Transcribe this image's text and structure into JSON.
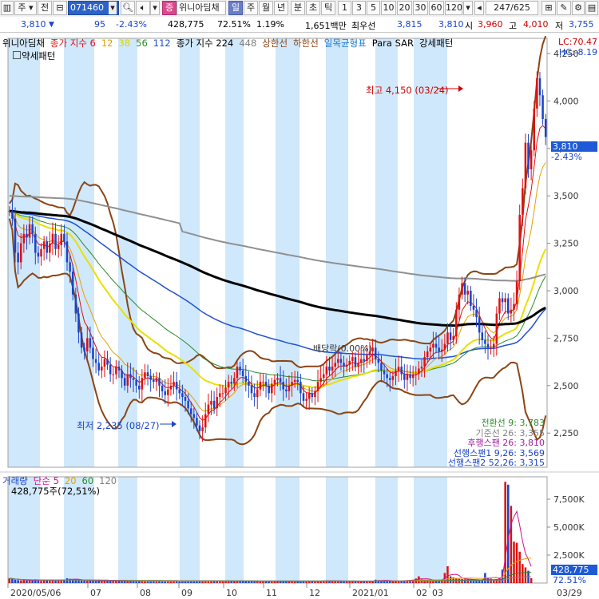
{
  "toolbar": {
    "type_label": "주",
    "prev_label": "전",
    "code": "071460",
    "stock_name": "위니아딤채",
    "stock_badge": "증",
    "periods": [
      "일",
      "주",
      "월",
      "년",
      "분",
      "초",
      "틱"
    ],
    "selected_period": "일",
    "intervals": [
      "1",
      "3",
      "5",
      "10",
      "20",
      "30",
      "60",
      "120"
    ],
    "page_count": "247/625"
  },
  "quote": {
    "price": "3,810",
    "change": "95",
    "change_pct": "-2.43%",
    "volume": "428,775",
    "vol_ratio": "72.51%",
    "turnover": "1.19%",
    "amount": "1,651백만",
    "best_ask_label": "최우선",
    "best_ask": "3,815",
    "bid": "3,810",
    "open_label": "시",
    "open": "3,960",
    "high_label": "고",
    "high": "4,010",
    "low_label": "저",
    "low": "3,755"
  },
  "price_pane": {
    "legend": [
      {
        "text": "위니아딤채",
        "color": "#000000"
      },
      {
        "text": "종가 지수 6",
        "color": "#e01010"
      },
      {
        "text": "12",
        "color": "#e8a000"
      },
      {
        "text": "38",
        "color": "#d8d800"
      },
      {
        "text": "56",
        "color": "#2a8a2a"
      },
      {
        "text": "112",
        "color": "#2050d0"
      },
      {
        "text": "종가 지수 224",
        "color": "#000000"
      },
      {
        "text": "448",
        "color": "#808080"
      },
      {
        "text": "상한선",
        "color": "#8b4513"
      },
      {
        "text": "하한선",
        "color": "#8b4513"
      },
      {
        "text": "일목균형표",
        "color": "#1a7ad0"
      },
      {
        "text": "Para SAR",
        "color": "#000000"
      },
      {
        "text": "강세패턴",
        "color": "#000000"
      }
    ],
    "legend_line2": "약세패턴",
    "lc": "LC:70.47",
    "hc": "HC:-8.19",
    "price_box": "3,810",
    "price_box_pct": "-2.43%",
    "high_annotation": "최고 4,150 (03/24)",
    "low_annotation": "최저 2,235 (08/27)",
    "mid_annotation": "배당락(0.00%)",
    "ichimoku": [
      {
        "text": "전환선 9: 3,783",
        "color": "#2a8a2a"
      },
      {
        "text": "기준선 26: 3,355",
        "color": "#808080"
      },
      {
        "text": "후행스팬 26: 3,810",
        "color": "#a020a0"
      },
      {
        "text": "선행스팬1 9,26: 3,569",
        "color": "#1a44c8"
      },
      {
        "text": "선행스팬2 52,26: 3,315",
        "color": "#1a44c8"
      }
    ]
  },
  "volume_pane": {
    "legend": [
      {
        "text": "거래량",
        "color": "#1a44c8"
      },
      {
        "text": "단순 5",
        "color": "#d01090"
      },
      {
        "text": "20",
        "color": "#e8a000"
      },
      {
        "text": "60",
        "color": "#2a8a2a"
      },
      {
        "text": "120",
        "color": "#808080"
      }
    ],
    "value_line": "428,775주(72,51%)",
    "box_value": "428,775",
    "box_pct": "72.51%"
  },
  "date_axis": {
    "labels": [
      "2020/05/06",
      "07",
      "08",
      "09",
      "10",
      "11",
      "12",
      "2021/01",
      "02",
      "03"
    ],
    "right_label": "03/29"
  },
  "chart_data": {
    "type": "candlestick",
    "y_ticks": [
      "4,250",
      "4,000",
      "3,750",
      "3,500",
      "3,250",
      "3,000",
      "2,750",
      "2,500",
      "2,250"
    ],
    "ylim": [
      2070,
      4330
    ],
    "volume_ticks": [
      "7,500K",
      "5,000K",
      "2,500K"
    ],
    "volume_ylim": [
      0,
      9500
    ],
    "x_categories": [
      "2020/05/06",
      "07",
      "08",
      "09",
      "10",
      "11",
      "12",
      "2021/01",
      "02",
      "03"
    ],
    "closes": [
      3420,
      3380,
      3200,
      3150,
      3250,
      3300,
      3280,
      3350,
      3300,
      3200,
      3180,
      3220,
      3260,
      3200,
      3250,
      3300,
      3220,
      3240,
      3300,
      3260,
      3150,
      3100,
      2980,
      2880,
      2780,
      2700,
      2680,
      2750,
      2700,
      2640,
      2620,
      2580,
      2600,
      2640,
      2610,
      2560,
      2560,
      2600,
      2580,
      2540,
      2500,
      2560,
      2540,
      2530,
      2500,
      2480,
      2540,
      2570,
      2550,
      2530,
      2520,
      2540,
      2500,
      2470,
      2450,
      2480,
      2500,
      2520,
      2480,
      2460,
      2440,
      2420,
      2380,
      2350,
      2330,
      2290,
      2260,
      2280,
      2350,
      2400,
      2420,
      2380,
      2440,
      2460,
      2460,
      2490,
      2520,
      2510,
      2540,
      2600,
      2580,
      2550,
      2520,
      2500,
      2460,
      2440,
      2480,
      2520,
      2520,
      2500,
      2460,
      2510,
      2530,
      2540,
      2520,
      2480,
      2470,
      2500,
      2520,
      2530,
      2520,
      2460,
      2420,
      2430,
      2460,
      2440,
      2470,
      2520,
      2540,
      2560,
      2600,
      2580,
      2600,
      2620,
      2640,
      2620,
      2600,
      2610,
      2630,
      2650,
      2600,
      2620,
      2640,
      2630,
      2660,
      2680,
      2700,
      2640,
      2620,
      2580,
      2560,
      2540,
      2530,
      2550,
      2580,
      2600,
      2560,
      2530,
      2560,
      2540,
      2560,
      2560,
      2590,
      2600,
      2650,
      2680,
      2700,
      2720,
      2700,
      2680,
      2690,
      2720,
      2780,
      2740,
      2760,
      2900,
      2980,
      3040,
      2980,
      3000,
      2920,
      2900,
      2860,
      2780,
      2740,
      2720,
      2700,
      2700,
      2720,
      2880,
      2960,
      2940,
      2960,
      2880,
      2900,
      2930,
      3050,
      3400,
      3540,
      3780,
      3640,
      3740,
      3960,
      4120,
      4030,
      3905,
      3810
    ],
    "volumes": [
      420,
      380,
      300,
      260,
      240,
      280,
      220,
      260,
      240,
      300,
      260,
      200,
      220,
      240,
      260,
      220,
      200,
      240,
      260,
      300,
      420,
      380,
      340,
      300,
      260,
      240,
      220,
      200,
      220,
      180,
      160,
      180,
      200,
      160,
      180,
      160,
      200,
      180,
      160,
      140,
      160,
      180,
      160,
      140,
      160,
      180,
      160,
      140,
      160,
      180,
      200,
      180,
      160,
      140,
      160,
      180,
      160,
      150,
      140,
      160,
      180,
      200,
      180,
      160,
      180,
      200,
      220,
      180,
      160,
      200,
      220,
      180,
      160,
      150,
      160,
      180,
      160,
      150,
      160,
      200,
      180,
      160,
      150,
      140,
      160,
      180,
      160,
      150,
      140,
      150,
      140,
      160,
      150,
      140,
      160,
      150,
      140,
      150,
      140,
      160,
      150,
      160,
      170,
      160,
      150,
      140,
      160,
      180,
      200,
      220,
      240,
      200,
      180,
      160,
      180,
      200,
      180,
      160,
      150,
      140,
      160,
      150,
      140,
      150,
      160,
      180,
      200,
      300,
      260,
      240,
      220,
      200,
      180,
      160,
      180,
      200,
      220,
      240,
      260,
      280,
      300,
      400,
      600,
      320,
      280,
      260,
      240,
      260,
      280,
      300,
      320,
      900,
      1500,
      600,
      500,
      400,
      380,
      360,
      340,
      320,
      300,
      280,
      300,
      260,
      280,
      900,
      500,
      400,
      300,
      360,
      400,
      1200,
      9050,
      8800,
      6900,
      3700,
      3600,
      2800,
      1700,
      1400,
      1100,
      430
    ]
  }
}
